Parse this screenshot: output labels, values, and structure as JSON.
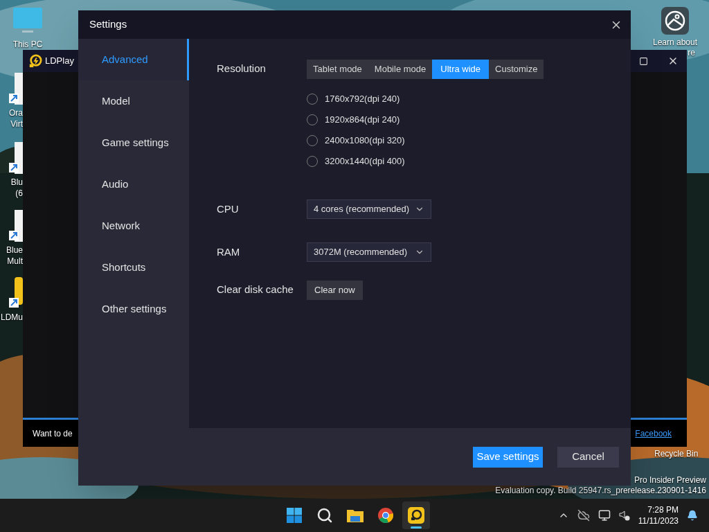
{
  "desktop": {
    "icons": [
      {
        "kind": "monitor",
        "lines": [
          "This PC"
        ]
      },
      {
        "kind": "shortcut",
        "lines": [
          "Ora",
          "Virt"
        ]
      },
      {
        "kind": "shortcut",
        "lines": [
          "Blu",
          "(6"
        ]
      },
      {
        "kind": "shortcut",
        "lines": [
          "Blue",
          "Mult"
        ]
      },
      {
        "kind": "ldplayer",
        "lines": [
          "LDMu"
        ]
      }
    ],
    "learn_about": [
      "Learn about",
      "re"
    ],
    "recycle_bin": "Recycle Bin",
    "watermark": [
      "Pro Insider Preview",
      "Evaluation copy. Build 25947.rs_prerelease.230901-1416"
    ]
  },
  "ldplayer": {
    "title": "LDPlay",
    "banner": {
      "text": "Want to de",
      "link": "Facebook"
    }
  },
  "settings": {
    "title": "Settings",
    "sidebar": [
      {
        "label": "Advanced",
        "selected": true
      },
      {
        "label": "Model",
        "selected": false
      },
      {
        "label": "Game settings",
        "selected": false
      },
      {
        "label": "Audio",
        "selected": false
      },
      {
        "label": "Network",
        "selected": false
      },
      {
        "label": "Shortcuts",
        "selected": false
      },
      {
        "label": "Other settings",
        "selected": false
      }
    ],
    "resolution": {
      "label": "Resolution",
      "modes": [
        {
          "label": "Tablet mode",
          "selected": false
        },
        {
          "label": "Mobile mode",
          "selected": false
        },
        {
          "label": "Ultra wide",
          "selected": true
        },
        {
          "label": "Customize",
          "selected": false
        }
      ],
      "options": [
        {
          "label": "1760x792(dpi 240)",
          "selected": false
        },
        {
          "label": "1920x864(dpi 240)",
          "selected": false
        },
        {
          "label": "2400x1080(dpi 320)",
          "selected": false
        },
        {
          "label": "3200x1440(dpi 400)",
          "selected": false
        }
      ]
    },
    "cpu": {
      "label": "CPU",
      "value": "4 cores (recommended)"
    },
    "ram": {
      "label": "RAM",
      "value": "3072M (recommended)"
    },
    "cache": {
      "label": "Clear disk cache",
      "button": "Clear now"
    },
    "buttons": [
      {
        "kind": "primary",
        "label": "Save settings"
      },
      {
        "kind": "secondary",
        "label": "Cancel"
      }
    ]
  },
  "taskbar": {
    "apps": [
      {
        "kind": "start",
        "selected": false
      },
      {
        "kind": "search",
        "selected": false
      },
      {
        "kind": "folder",
        "selected": false
      },
      {
        "kind": "browser",
        "selected": false
      },
      {
        "kind": "ldplayer",
        "selected": true
      }
    ],
    "time": "7:28 PM",
    "date": "11/11/2023"
  }
}
